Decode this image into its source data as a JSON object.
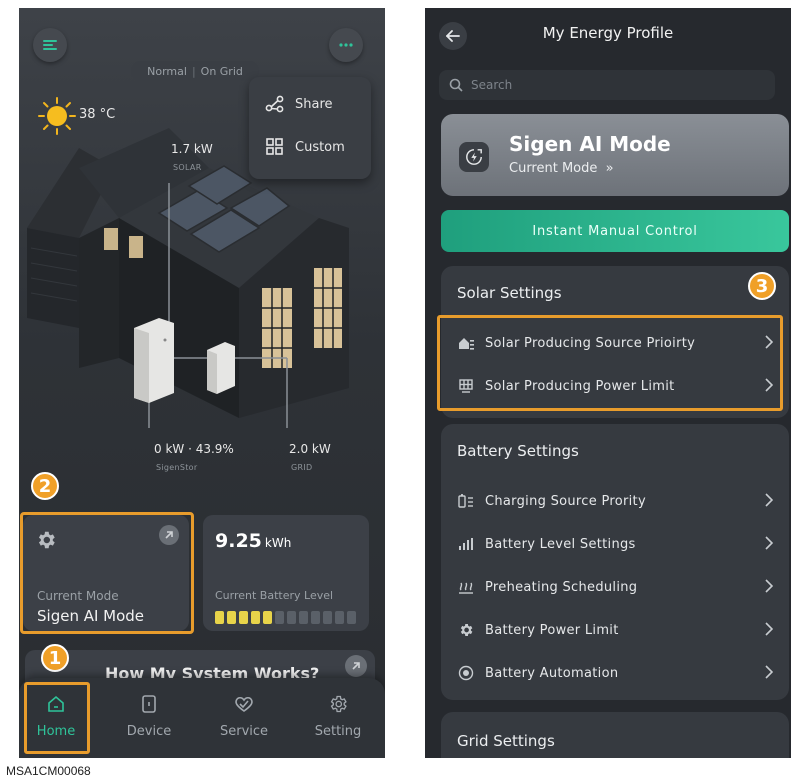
{
  "home": {
    "status": {
      "mode": "Normal",
      "grid": "On Grid"
    },
    "weather": {
      "temperature": "38 °C",
      "icon": "sun-icon"
    },
    "menu": {
      "share_label": "Share",
      "custom_label": "Custom"
    },
    "flow": {
      "solar_value": "1.7 kW",
      "solar_label": "SOLAR",
      "battery_value": "0 kW · 43.9%",
      "battery_label": "SigenStor",
      "grid_value": "2.0 kW",
      "grid_label": "GRID"
    },
    "mode_card": {
      "label": "Current Mode",
      "value": "Sigen AI Mode"
    },
    "battery_card": {
      "value": "9.25",
      "unit": "kWh",
      "label": "Current Battery Level",
      "level_fraction": 0.4
    },
    "how_card": {
      "title": "How My System Works?"
    },
    "tabs": [
      {
        "label": "Home",
        "icon": "home-icon",
        "active": true
      },
      {
        "label": "Device",
        "icon": "device-icon",
        "active": false
      },
      {
        "label": "Service",
        "icon": "service-icon",
        "active": false
      },
      {
        "label": "Setting",
        "icon": "gear-icon",
        "active": false
      }
    ],
    "callouts": {
      "one": "1",
      "two": "2"
    }
  },
  "profile": {
    "title": "My Energy Profile",
    "search_placeholder": "Search",
    "mode": {
      "title": "Sigen AI Mode",
      "subtitle": "Current Mode",
      "arrow": "»"
    },
    "instant_button": "Instant Manual Control",
    "callout": "3",
    "solar": {
      "header": "Solar Settings",
      "items": [
        "Solar Producing Source Prioirty",
        "Solar Producing Power Limit"
      ]
    },
    "battery": {
      "header": "Battery Settings",
      "items": [
        "Charging Source Prority",
        "Battery Level Settings",
        "Preheating Scheduling",
        "Battery Power Limit",
        "Battery Automation"
      ]
    },
    "grid": {
      "header": "Grid Settings"
    }
  },
  "caption": "MSA1CM00068",
  "colors": {
    "accent": "#2fc49a",
    "highlight": "#e89c2c",
    "battery_on": "#e8d44a"
  }
}
